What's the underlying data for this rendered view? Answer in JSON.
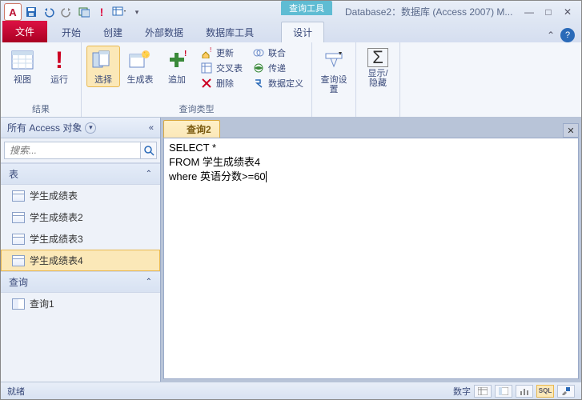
{
  "app_letter": "A",
  "context_tool": "查询工具",
  "window_title": "Database2：数据库 (Access 2007) M...",
  "tabs": {
    "file": "文件",
    "home": "开始",
    "create": "创建",
    "external": "外部数据",
    "dbtools": "数据库工具",
    "design": "设计"
  },
  "ribbon": {
    "results_group": "结果",
    "view": "视图",
    "run": "运行",
    "select": "选择",
    "maketable": "生成表",
    "append": "追加",
    "update": "更新",
    "crosstab": "交叉表",
    "delete": "删除",
    "union": "联合",
    "passthrough": "传递",
    "datadef": "数据定义",
    "querytype_group": "查询类型",
    "querysetup": "查询设置",
    "showhide": "显示/隐藏"
  },
  "nav": {
    "header": "所有 Access 对象",
    "search_placeholder": "搜索...",
    "tables_label": "表",
    "queries_label": "查询",
    "tables": [
      "学生成绩表",
      "学生成绩表2",
      "学生成绩表3",
      "学生成绩表4"
    ],
    "queries": [
      "查询1"
    ]
  },
  "doc": {
    "tab_title": "查询2",
    "sql_line1": "SELECT *",
    "sql_line2": "FROM 学生成绩表4",
    "sql_line3": "where 英语分数>=60"
  },
  "status": {
    "left": "就绪",
    "numlock": "数字",
    "sql": "SQL"
  }
}
